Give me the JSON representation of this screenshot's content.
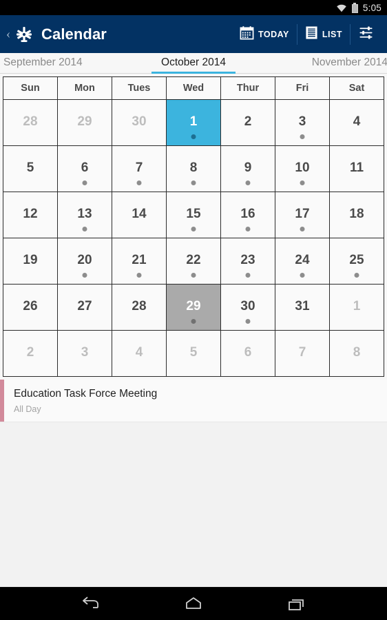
{
  "status_bar": {
    "clock": "5:05",
    "icons": [
      "wifi-icon",
      "battery-icon"
    ]
  },
  "app_bar": {
    "back_label": "‹",
    "logo": "snowflake-logo",
    "title": "Calendar",
    "actions": [
      {
        "name": "today-button",
        "icon": "calendar-icon",
        "label": "TODAY"
      },
      {
        "name": "list-button",
        "icon": "list-icon",
        "label": "LIST"
      },
      {
        "name": "filter-button",
        "icon": "sliders-icon",
        "label": ""
      }
    ]
  },
  "month_strip": {
    "previous": "September 2014",
    "current": "October 2014",
    "next": "November 2014",
    "accent_color": "#3cb4de"
  },
  "calendar": {
    "weekday_headers": [
      "Sun",
      "Mon",
      "Tues",
      "Wed",
      "Thur",
      "Fri",
      "Sat"
    ],
    "selected_date": 1,
    "today_date": 29,
    "weeks": [
      [
        {
          "num": "28",
          "muted": true,
          "dot": false,
          "state": ""
        },
        {
          "num": "29",
          "muted": true,
          "dot": false,
          "state": ""
        },
        {
          "num": "30",
          "muted": true,
          "dot": false,
          "state": ""
        },
        {
          "num": "1",
          "muted": false,
          "dot": true,
          "state": "selected"
        },
        {
          "num": "2",
          "muted": false,
          "dot": false,
          "state": ""
        },
        {
          "num": "3",
          "muted": false,
          "dot": true,
          "state": ""
        },
        {
          "num": "4",
          "muted": false,
          "dot": false,
          "state": ""
        }
      ],
      [
        {
          "num": "5",
          "muted": false,
          "dot": false,
          "state": ""
        },
        {
          "num": "6",
          "muted": false,
          "dot": true,
          "state": ""
        },
        {
          "num": "7",
          "muted": false,
          "dot": true,
          "state": ""
        },
        {
          "num": "8",
          "muted": false,
          "dot": true,
          "state": ""
        },
        {
          "num": "9",
          "muted": false,
          "dot": true,
          "state": ""
        },
        {
          "num": "10",
          "muted": false,
          "dot": true,
          "state": ""
        },
        {
          "num": "11",
          "muted": false,
          "dot": false,
          "state": ""
        }
      ],
      [
        {
          "num": "12",
          "muted": false,
          "dot": false,
          "state": ""
        },
        {
          "num": "13",
          "muted": false,
          "dot": true,
          "state": ""
        },
        {
          "num": "14",
          "muted": false,
          "dot": false,
          "state": ""
        },
        {
          "num": "15",
          "muted": false,
          "dot": true,
          "state": ""
        },
        {
          "num": "16",
          "muted": false,
          "dot": true,
          "state": ""
        },
        {
          "num": "17",
          "muted": false,
          "dot": true,
          "state": ""
        },
        {
          "num": "18",
          "muted": false,
          "dot": false,
          "state": ""
        }
      ],
      [
        {
          "num": "19",
          "muted": false,
          "dot": false,
          "state": ""
        },
        {
          "num": "20",
          "muted": false,
          "dot": true,
          "state": ""
        },
        {
          "num": "21",
          "muted": false,
          "dot": true,
          "state": ""
        },
        {
          "num": "22",
          "muted": false,
          "dot": true,
          "state": ""
        },
        {
          "num": "23",
          "muted": false,
          "dot": true,
          "state": ""
        },
        {
          "num": "24",
          "muted": false,
          "dot": true,
          "state": ""
        },
        {
          "num": "25",
          "muted": false,
          "dot": true,
          "state": ""
        }
      ],
      [
        {
          "num": "26",
          "muted": false,
          "dot": false,
          "state": ""
        },
        {
          "num": "27",
          "muted": false,
          "dot": false,
          "state": ""
        },
        {
          "num": "28",
          "muted": false,
          "dot": false,
          "state": ""
        },
        {
          "num": "29",
          "muted": false,
          "dot": true,
          "state": "today"
        },
        {
          "num": "30",
          "muted": false,
          "dot": true,
          "state": ""
        },
        {
          "num": "31",
          "muted": false,
          "dot": false,
          "state": ""
        },
        {
          "num": "1",
          "muted": true,
          "dot": false,
          "state": ""
        }
      ],
      [
        {
          "num": "2",
          "muted": true,
          "dot": false,
          "state": ""
        },
        {
          "num": "3",
          "muted": true,
          "dot": false,
          "state": ""
        },
        {
          "num": "4",
          "muted": true,
          "dot": false,
          "state": ""
        },
        {
          "num": "5",
          "muted": true,
          "dot": false,
          "state": ""
        },
        {
          "num": "6",
          "muted": true,
          "dot": false,
          "state": ""
        },
        {
          "num": "7",
          "muted": true,
          "dot": false,
          "state": ""
        },
        {
          "num": "8",
          "muted": true,
          "dot": false,
          "state": ""
        }
      ]
    ]
  },
  "events": [
    {
      "title": "Education Task Force Meeting",
      "subtitle": "All Day",
      "accent_color": "#d28a9b"
    }
  ],
  "nav_bar": {
    "buttons": [
      "back-icon",
      "home-icon",
      "recents-icon"
    ]
  },
  "theme": {
    "app_bar_bg": "#033263",
    "selected_day_bg": "#3cb4de",
    "today_bg": "#aaaaaa",
    "page_bg": "#f7f7f7"
  }
}
